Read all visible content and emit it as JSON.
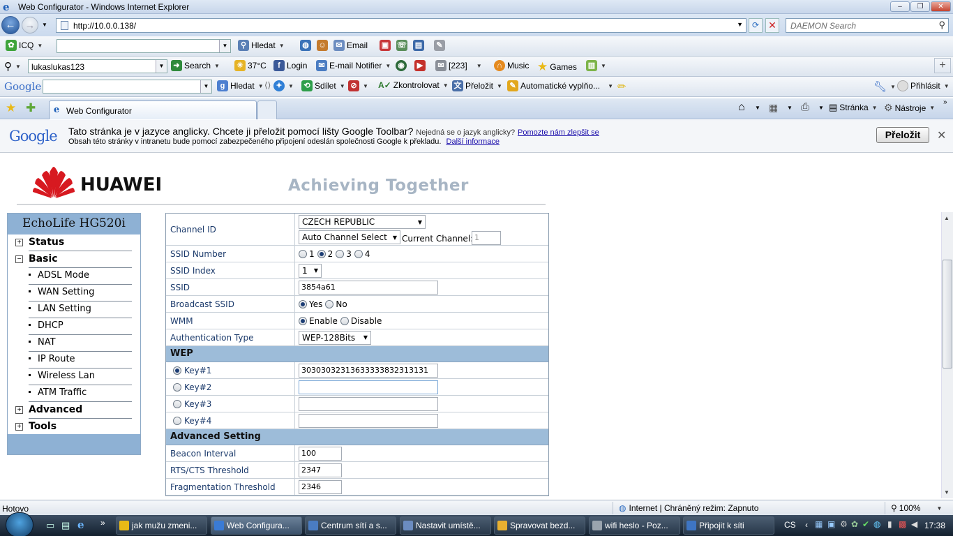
{
  "window": {
    "title": "Web Configurator - Windows Internet Explorer"
  },
  "address": {
    "url": "http://10.0.0.138/",
    "search_placeholder": "DAEMON Search"
  },
  "toolbar1": {
    "icq": "ICQ",
    "hledat": "Hledat",
    "email": "Email"
  },
  "toolbar2": {
    "user": "lukaslukas123",
    "search": "Search",
    "temp": "37°C",
    "login": "Login",
    "notifier": "E-mail Notifier",
    "count": "[223]",
    "music": "Music",
    "games": "Games"
  },
  "toolbar3": {
    "google": "Google",
    "hledat": "Hledat",
    "sdilet": "Sdílet",
    "zkontrolovat": "Zkontrolovat",
    "prelozit": "Přeložit",
    "autofill": "Automatické vyplňo...",
    "prihlasit": "Přihlásit"
  },
  "tabs": {
    "tab1": "Web Configurator",
    "stranka": "Stránka",
    "nastroje": "Nástroje"
  },
  "gbar": {
    "logo": "Google",
    "line1": "Tato stránka je v jazyce anglicky. Chcete ji přeložit pomocí lišty Google Toolbar?",
    "not_lang": "Nejedná se o jazyk anglicky?",
    "help_link": "Pomozte nám zlepšit se",
    "line2": "Obsah této stránky v intranetu bude pomocí zabezpečeného připojení odeslán společnosti Google k překladu.",
    "more_link": "Další informace",
    "button": "Přeložit"
  },
  "page": {
    "brand": "HUAWEI",
    "tagline": "Achieving Together",
    "colors": {
      "nav_header": "#8eb1d4",
      "section_header": "#9dbcd9",
      "label": "#1b3a6b"
    }
  },
  "nav": {
    "title": "EchoLife HG520i",
    "items": [
      {
        "label": "Status",
        "type": "group",
        "state": "+"
      },
      {
        "label": "Basic",
        "type": "group",
        "state": "−"
      },
      {
        "label": "ADSL Mode",
        "type": "sub"
      },
      {
        "label": "WAN Setting",
        "type": "sub"
      },
      {
        "label": "LAN Setting",
        "type": "sub"
      },
      {
        "label": "DHCP",
        "type": "sub"
      },
      {
        "label": "NAT",
        "type": "sub"
      },
      {
        "label": "IP Route",
        "type": "sub"
      },
      {
        "label": "Wireless Lan",
        "type": "sub"
      },
      {
        "label": "ATM Traffic",
        "type": "sub"
      },
      {
        "label": "Advanced",
        "type": "group",
        "state": "+"
      },
      {
        "label": "Tools",
        "type": "group",
        "state": "+"
      }
    ]
  },
  "form": {
    "channel_id": {
      "label": "Channel ID",
      "country": "CZECH REPUBLIC",
      "mode": "Auto Channel Select",
      "current_label": "Current Channel:",
      "current_value": "1"
    },
    "ssid_number": {
      "label": "SSID Number",
      "options": [
        "1",
        "2",
        "3",
        "4"
      ],
      "selected": "2"
    },
    "ssid_index": {
      "label": "SSID Index",
      "value": "1"
    },
    "ssid": {
      "label": "SSID",
      "value": "3854a61"
    },
    "broadcast": {
      "label": "Broadcast SSID",
      "yes": "Yes",
      "no": "No",
      "selected": "Yes"
    },
    "wmm": {
      "label": "WMM",
      "enable": "Enable",
      "disable": "Disable",
      "selected": "Enable"
    },
    "auth": {
      "label": "Authentication Type",
      "value": "WEP-128Bits"
    },
    "wep_title": "WEP",
    "keys": [
      {
        "label": "Key#1",
        "value": "30303032313633333832313131",
        "selected": true
      },
      {
        "label": "Key#2",
        "value": "",
        "selected": false
      },
      {
        "label": "Key#3",
        "value": "",
        "selected": false
      },
      {
        "label": "Key#4",
        "value": "",
        "selected": false
      }
    ],
    "adv_title": "Advanced Setting",
    "beacon": {
      "label": "Beacon Interval",
      "value": "100"
    },
    "rts": {
      "label": "RTS/CTS Threshold",
      "value": "2347"
    },
    "frag": {
      "label": "Fragmentation Threshold",
      "value": "2346"
    }
  },
  "status": {
    "text": "Hotovo",
    "zone": "Internet | Chráněný režim: Zapnuto",
    "zoom": "100%"
  },
  "taskbar": {
    "items": [
      "jak mužu zmeni...",
      "Web Configura...",
      "Centrum sítí a s...",
      "Nastavit umístě...",
      "Spravovat bezd...",
      "wifi heslo - Poz...",
      "Připojit k síti"
    ],
    "lang": "CS",
    "clock": "17:38"
  }
}
